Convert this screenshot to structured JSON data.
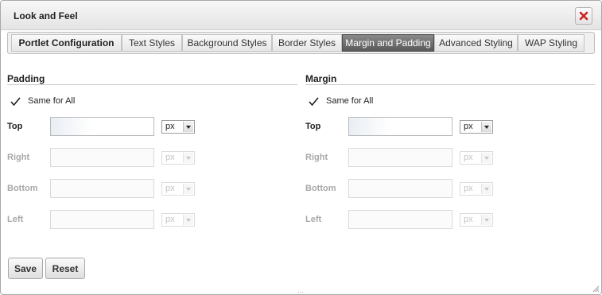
{
  "dialog": {
    "title": "Look and Feel",
    "close_icon": "close-icon",
    "close_color": "#cc2222"
  },
  "tabs": [
    {
      "label": "Portlet Configuration"
    },
    {
      "label": "Text Styles"
    },
    {
      "label": "Background Styles"
    },
    {
      "label": "Border Styles"
    },
    {
      "label": "Margin and Padding",
      "active": true
    },
    {
      "label": "Advanced Styling"
    },
    {
      "label": "WAP Styling"
    }
  ],
  "padding": {
    "title": "Padding",
    "same_for_all_label": "Same for All",
    "same_for_all_checked": true,
    "rows": [
      {
        "label": "Top",
        "value": "",
        "unit": "px",
        "enabled": true
      },
      {
        "label": "Right",
        "value": "",
        "unit": "px",
        "enabled": false
      },
      {
        "label": "Bottom",
        "value": "",
        "unit": "px",
        "enabled": false
      },
      {
        "label": "Left",
        "value": "",
        "unit": "px",
        "enabled": false
      }
    ]
  },
  "margin": {
    "title": "Margin",
    "same_for_all_label": "Same for All",
    "same_for_all_checked": true,
    "rows": [
      {
        "label": "Top",
        "value": "",
        "unit": "px",
        "enabled": true
      },
      {
        "label": "Right",
        "value": "",
        "unit": "px",
        "enabled": false
      },
      {
        "label": "Bottom",
        "value": "",
        "unit": "px",
        "enabled": false
      },
      {
        "label": "Left",
        "value": "",
        "unit": "px",
        "enabled": false
      }
    ]
  },
  "actions": {
    "save_label": "Save",
    "reset_label": "Reset"
  },
  "colors": {
    "active_tab": "#6b6b6b",
    "disabled_text": "#a8a8a8"
  }
}
